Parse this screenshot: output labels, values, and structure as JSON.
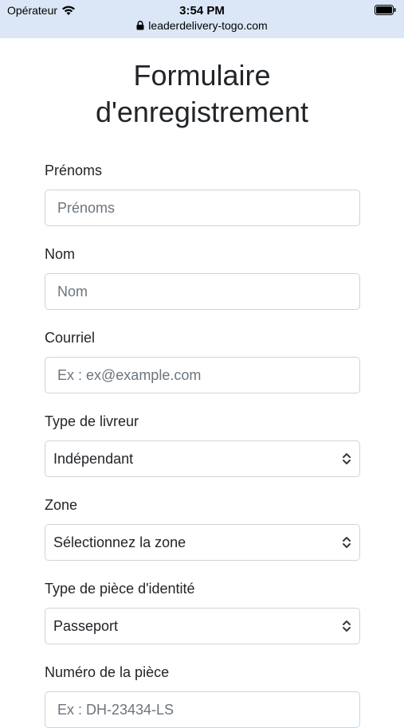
{
  "status_bar": {
    "carrier": "Opérateur",
    "time": "3:54 PM",
    "url": "leaderdelivery-togo.com"
  },
  "page": {
    "title_line1": "Formulaire",
    "title_line2": "d'enregistrement"
  },
  "form": {
    "first_name": {
      "label": "Prénoms",
      "placeholder": "Prénoms"
    },
    "last_name": {
      "label": "Nom",
      "placeholder": "Nom"
    },
    "email": {
      "label": "Courriel",
      "placeholder": "Ex : ex@example.com"
    },
    "courier_type": {
      "label": "Type de livreur",
      "value": "Indépendant"
    },
    "zone": {
      "label": "Zone",
      "value": "Sélectionnez la zone"
    },
    "id_type": {
      "label": "Type de pièce d'identité",
      "value": "Passeport"
    },
    "id_number": {
      "label": "Numéro de la pièce",
      "placeholder": "Ex : DH-23434-LS"
    }
  },
  "icons": {
    "wifi": "wifi-icon",
    "battery": "battery-icon",
    "lock": "lock-icon",
    "chevron": "chevron-up-down-icon"
  }
}
